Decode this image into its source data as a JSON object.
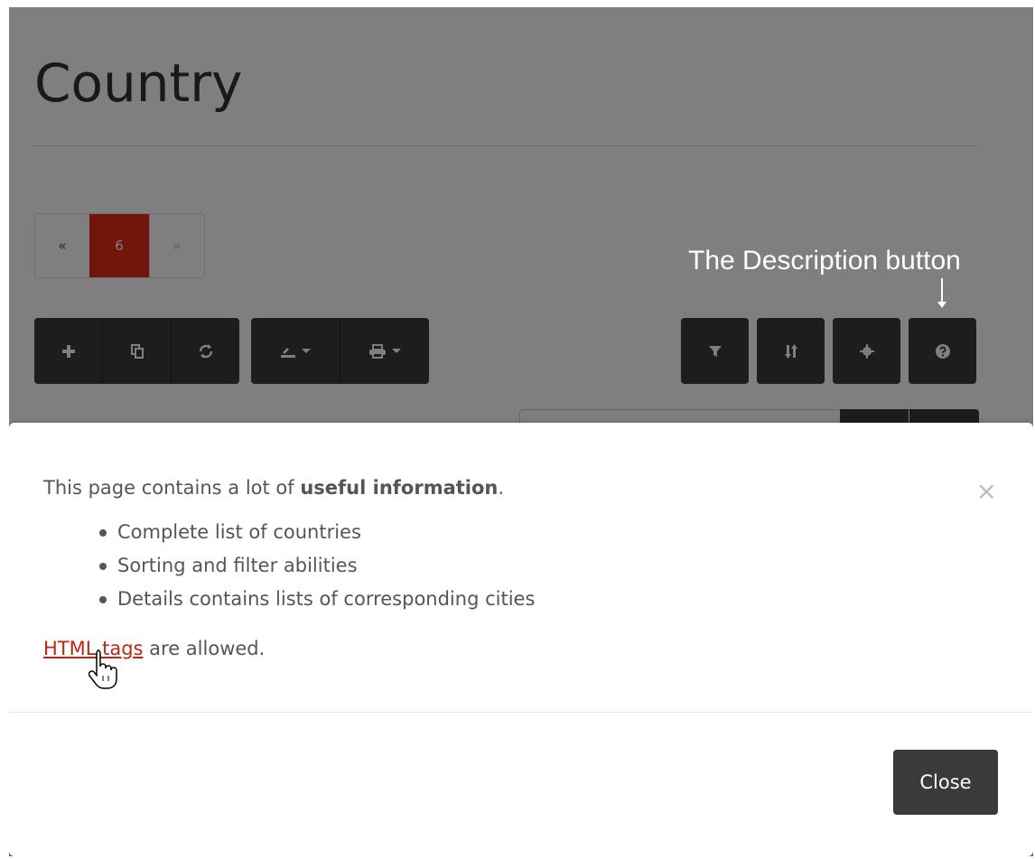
{
  "page": {
    "title": "Country",
    "pagination": {
      "prev_label": "«",
      "current_page": "6",
      "next_label": "»"
    },
    "toolbar": {
      "left_group": [
        {
          "icon": "plus-icon"
        },
        {
          "icon": "copy-icon"
        },
        {
          "icon": "refresh-icon"
        }
      ],
      "export_group": [
        {
          "icon": "export-icon"
        },
        {
          "icon": "print-icon"
        }
      ],
      "right_buttons": [
        {
          "icon": "filter-icon"
        },
        {
          "icon": "sort-icon"
        },
        {
          "icon": "settings-icon"
        },
        {
          "icon": "help-icon"
        }
      ]
    },
    "annotation": "The Description button"
  },
  "modal": {
    "intro_text": "This page contains a lot of ",
    "intro_bold": "useful information",
    "intro_end": ".",
    "items": [
      "Complete list of countries",
      "Sorting and filter abilities",
      "Details contains lists of corresponding cities"
    ],
    "link_text": "HTML tags",
    "note_text": " are allowed.",
    "close_x": "×",
    "close_button": "Close"
  },
  "colors": {
    "accent": "#e42a1a",
    "link": "#c02616",
    "button": "#3a3a3a"
  }
}
